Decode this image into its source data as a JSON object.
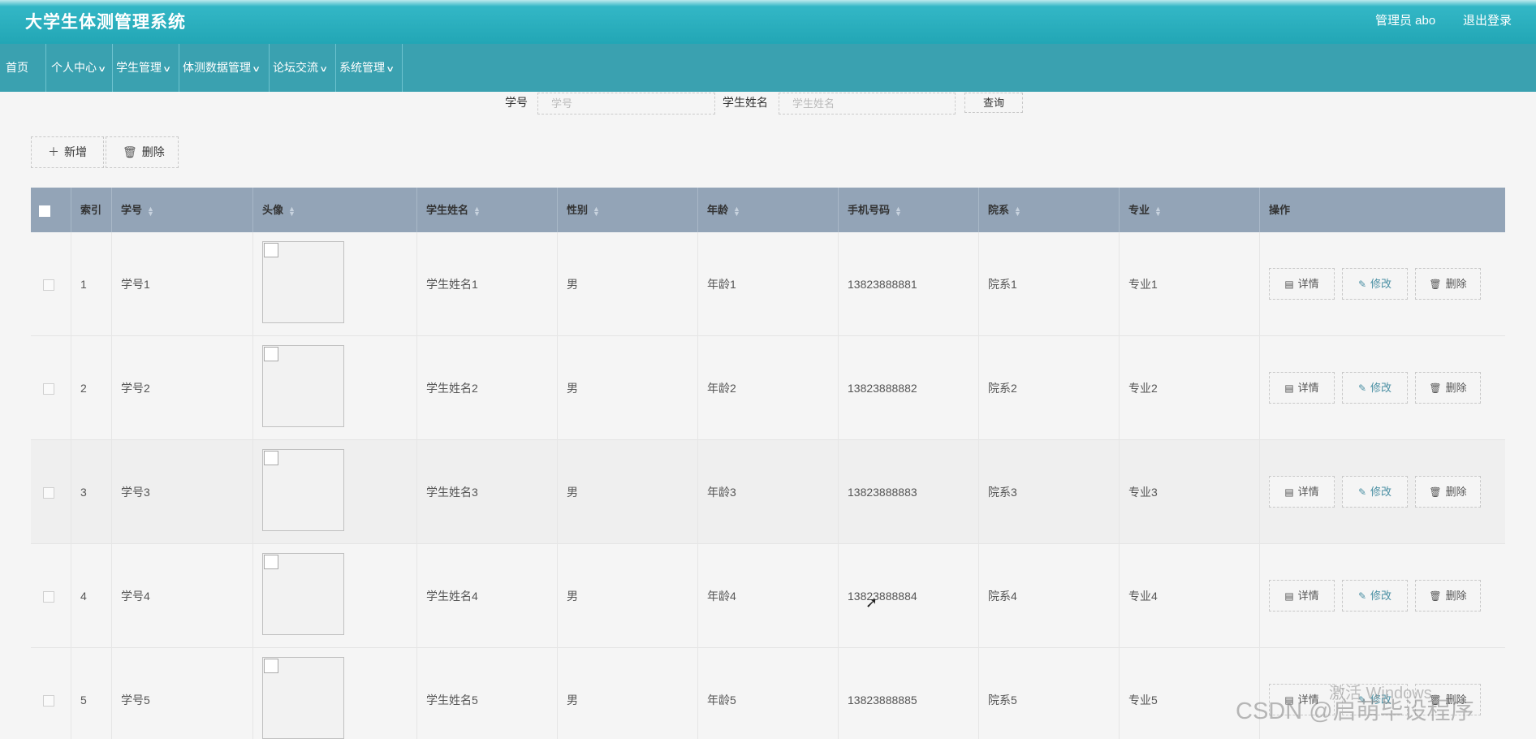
{
  "header": {
    "title": "大学生体测管理系统",
    "admin": "管理员 abo",
    "logout": "退出登录"
  },
  "nav": [
    {
      "label": "首页",
      "has_menu": false
    },
    {
      "label": "个人中心",
      "has_menu": true
    },
    {
      "label": "学生管理",
      "has_menu": true
    },
    {
      "label": "体测数据管理",
      "has_menu": true
    },
    {
      "label": "论坛交流",
      "has_menu": true
    },
    {
      "label": "系统管理",
      "has_menu": true
    }
  ],
  "search": {
    "student_no_label": "学号",
    "student_no_placeholder": "学号",
    "student_name_label": "学生姓名",
    "student_name_placeholder": "学生姓名",
    "query_button": "查询"
  },
  "toolbar": {
    "add_label": "新增",
    "delete_label": "删除"
  },
  "table": {
    "columns": [
      "索引",
      "学号",
      "头像",
      "学生姓名",
      "性别",
      "年龄",
      "手机号码",
      "院系",
      "专业",
      "操作"
    ],
    "rows": [
      {
        "index": "1",
        "student_no": "学号1",
        "name": "学生姓名1",
        "gender": "男",
        "age": "年龄1",
        "phone": "13823888881",
        "dept": "院系1",
        "major": "专业1"
      },
      {
        "index": "2",
        "student_no": "学号2",
        "name": "学生姓名2",
        "gender": "男",
        "age": "年龄2",
        "phone": "13823888882",
        "dept": "院系2",
        "major": "专业2"
      },
      {
        "index": "3",
        "student_no": "学号3",
        "name": "学生姓名3",
        "gender": "男",
        "age": "年龄3",
        "phone": "13823888883",
        "dept": "院系3",
        "major": "专业3"
      },
      {
        "index": "4",
        "student_no": "学号4",
        "name": "学生姓名4",
        "gender": "男",
        "age": "年龄4",
        "phone": "13823888884",
        "dept": "院系4",
        "major": "专业4"
      },
      {
        "index": "5",
        "student_no": "学号5",
        "name": "学生姓名5",
        "gender": "男",
        "age": "年龄5",
        "phone": "13823888885",
        "dept": "院系5",
        "major": "专业5"
      }
    ],
    "actions": {
      "detail": "详情",
      "edit": "修改",
      "delete": "删除"
    }
  },
  "overlay": {
    "activate_windows": "激活 Windows",
    "watermark": "CSDN @启萌毕设程序"
  },
  "colors": {
    "header": "#22a6b5",
    "nav": "#3aa1b0",
    "table_head": "#93a4b7",
    "background": "#f5f5f5"
  }
}
